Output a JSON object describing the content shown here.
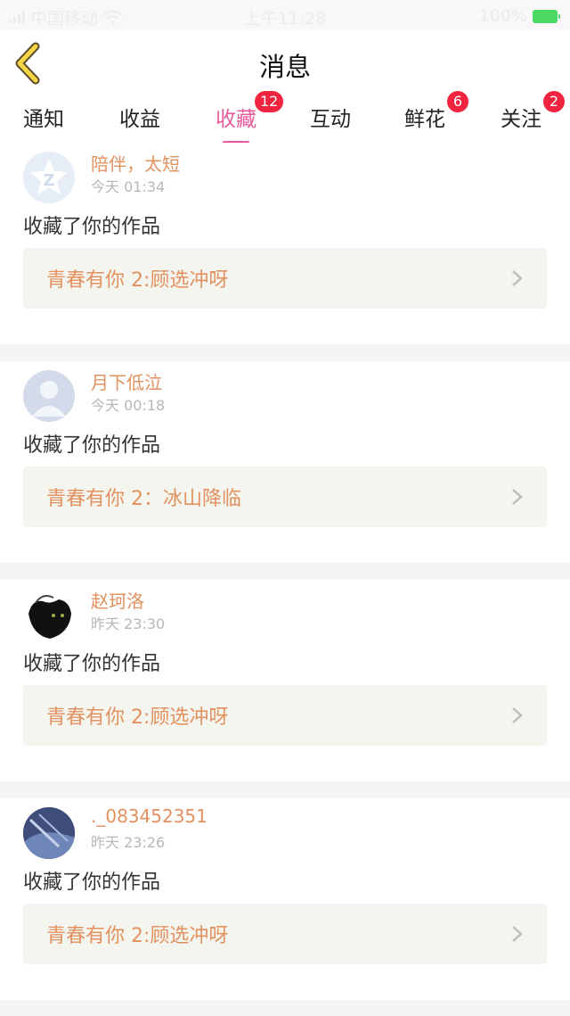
{
  "status_bar": {
    "carrier": "中国移动",
    "time": "上午11:28",
    "battery": "100%"
  },
  "header": {
    "title": "消息"
  },
  "tabs": [
    {
      "label": "通知",
      "badge": ""
    },
    {
      "label": "收益",
      "badge": ""
    },
    {
      "label": "收藏",
      "badge": "12",
      "active": true
    },
    {
      "label": "互动",
      "badge": ""
    },
    {
      "label": "鲜花",
      "badge": "6"
    },
    {
      "label": "关注",
      "badge": "2"
    }
  ],
  "colors": {
    "accent": "#e85a9b",
    "username": "#e2915f",
    "badge": "#f0243e",
    "work_bg": "#f5f5ef"
  },
  "messages": [
    {
      "username": "陪伴，太短",
      "time": "今天 01:34",
      "action": "收藏了你的作品",
      "work": "青春有你 2:顾选冲呀",
      "avatar": "default-qq-avatar-icon"
    },
    {
      "username": "月下低泣",
      "time": "今天 00:18",
      "action": "收藏了你的作品",
      "work": "青春有你 2：冰山降临",
      "avatar": "default-person-avatar-icon"
    },
    {
      "username": "赵珂洛",
      "time": "昨天 23:30",
      "action": "收藏了你的作品",
      "work": "青春有你 2:顾选冲呀",
      "avatar": "photo-avatar"
    },
    {
      "username": "._083452351",
      "time": "昨天 23:26",
      "action": "收藏了你的作品",
      "work": "青春有你 2:顾选冲呀",
      "avatar": "photo-avatar"
    }
  ]
}
